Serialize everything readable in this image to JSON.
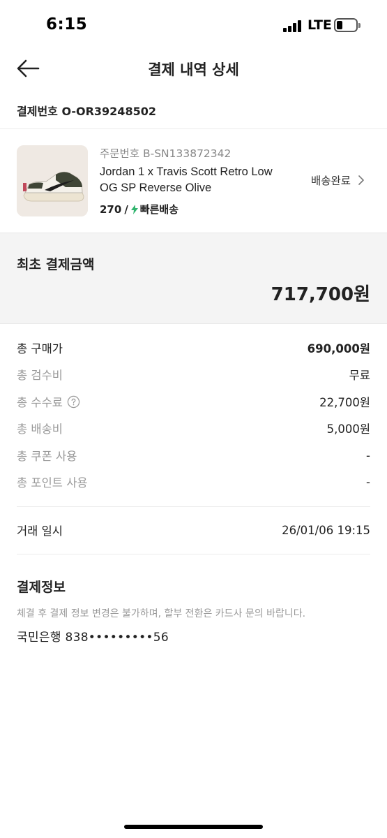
{
  "status_bar": {
    "time": "6:15",
    "network": "LTE",
    "battery_level": 0.25
  },
  "header": {
    "title": "결제 내역 상세"
  },
  "payment_number": "결제번호 O-OR39248502",
  "product": {
    "order_number": "주문번호 B-SN133872342",
    "name": "Jordan 1 x Travis Scott Retro Low OG SP Reverse Olive",
    "size": "270",
    "slash": "/",
    "shipping_type": "빠른배송",
    "status": "배송완료",
    "colors": {
      "fast_shipping_icon": "#31b46e"
    }
  },
  "total": {
    "label": "최초 결제금액",
    "value": "717,700원"
  },
  "breakdown": [
    {
      "label": "총 구매가",
      "value": "690,000원"
    },
    {
      "label": "총 검수비",
      "value": "무료"
    },
    {
      "label": "총 수수료",
      "value": "22,700원",
      "icon": "help-circle-icon"
    },
    {
      "label": "총 배송비",
      "value": "5,000원"
    },
    {
      "label": "총 쿠폰 사용",
      "value": "-"
    },
    {
      "label": "총 포인트 사용",
      "value": "-"
    }
  ],
  "transaction": {
    "label": "거래 일시",
    "value": "26/01/06 19:15"
  },
  "payment_info": {
    "title": "결제정보",
    "note": "체결 후 결제 정보 변경은 불가하며, 할부 전환은 카드사 문의 바랍니다.",
    "account": "국민은행 838•••••••••56"
  }
}
